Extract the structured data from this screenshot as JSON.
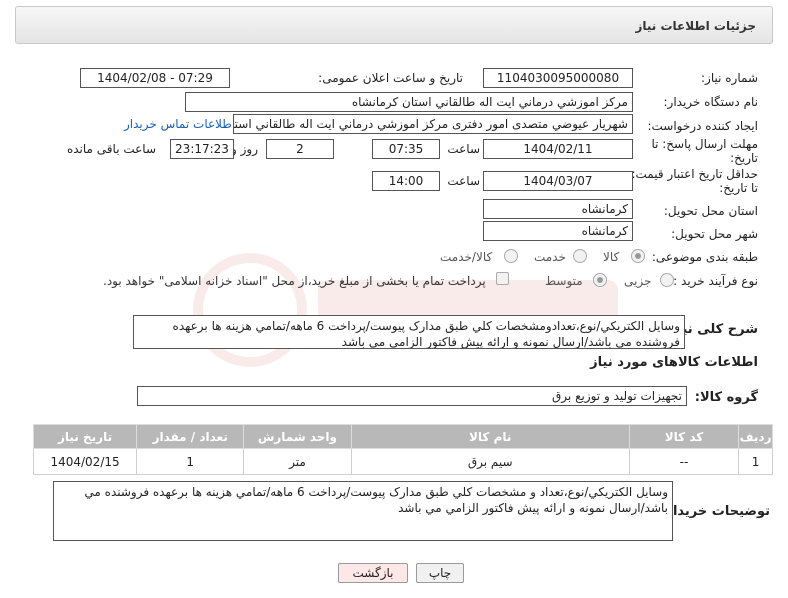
{
  "header": {
    "title": "جزئیات اطلاعات نیاز"
  },
  "form": {
    "need_number_label": "شماره نیاز:",
    "need_number": "1104030095000080",
    "announce_label": "تاریخ و ساعت اعلان عمومی:",
    "announce_value": "1404/02/08 - 07:29",
    "buyer_org_label": "نام دستگاه خریدار:",
    "buyer_org": "مرکز اموزشي درماني ايت اله طالقاني استان کرمانشاه",
    "creator_label": "ایجاد کننده درخواست:",
    "creator": "شهريار عيوضي متصدی امور دفتری مرکز اموزشي درماني ايت اله طالقاني استان کرمانشاه",
    "buyer_contact_link": "اطلاعات تماس خریدار",
    "deadline_label_1": "مهلت ارسال پاسخ: تا",
    "deadline_label_2": "تاریخ:",
    "deadline_date": "1404/02/11",
    "time_label": "ساعت",
    "deadline_time": "07:35",
    "days_value": "2",
    "days_label": "روز و",
    "remaining_time": "23:17:23",
    "remaining_label": "ساعت باقی مانده",
    "validity_label_1": "حداقل تاریخ اعتبار قیمت:",
    "validity_label_2": "تا تاریخ:",
    "validity_date": "1404/03/07",
    "validity_time_label": "ساعت",
    "validity_time": "14:00",
    "province_label": "استان محل تحویل:",
    "province": "کرمانشاه",
    "city_label": "شهر محل تحویل:",
    "city": "کرمانشاه",
    "category_label": "طبقه بندی موضوعی:",
    "category_options": [
      "کالا",
      "خدمت",
      "کالا/خدمت"
    ],
    "category_selected": "کالا",
    "process_label": "نوع فرآیند خرید :",
    "process_options": [
      "جزیی",
      "متوسط"
    ],
    "payment_note": "پرداخت تمام یا بخشی از مبلغ خرید،از محل \"اسناد خزانه اسلامی\" خواهد بود.",
    "summary_label": "شرح کلی نیاز:",
    "summary": "وسايل الکتريکي/نوع،تعدادومشخصات کلي طبق مدارک پيوست/پرداخت 6 ماهه/تمامي هزينه ها برعهده فروشنده مي باشد/ارسال نمونه و ارائه پيش فاکتور الزامي مي باشد"
  },
  "goods": {
    "section_title": "اطلاعات کالاهای مورد نیاز",
    "group_label": "گروه کالا:",
    "group_value": "تجهیزات تولید و توزیع برق",
    "columns": [
      "ردیف",
      "کد کالا",
      "نام کالا",
      "واحد شمارش",
      "تعداد / مقدار",
      "تاریخ نیاز"
    ],
    "rows": [
      {
        "row": "1",
        "code": "--",
        "name": "سیم برق",
        "unit": "متر",
        "qty": "1",
        "date": "1404/02/15"
      }
    ]
  },
  "buyer_notes": {
    "label": "توضیحات خریدار:",
    "text": "وسايل الکتريکي/نوع،تعداد و مشخصات کلي طبق مدارک پيوست/پرداخت 6 ماهه/تمامي هزينه ها برعهده فروشنده مي باشد/ارسال نمونه و ارائه پيش فاکتور الزامي مي باشد"
  },
  "buttons": {
    "print": "چاپ",
    "back": "بازگشت"
  },
  "colors": {
    "link": "#1a5fb4",
    "table_header": "#b8b8b8",
    "back_button": "#fde7e7"
  }
}
